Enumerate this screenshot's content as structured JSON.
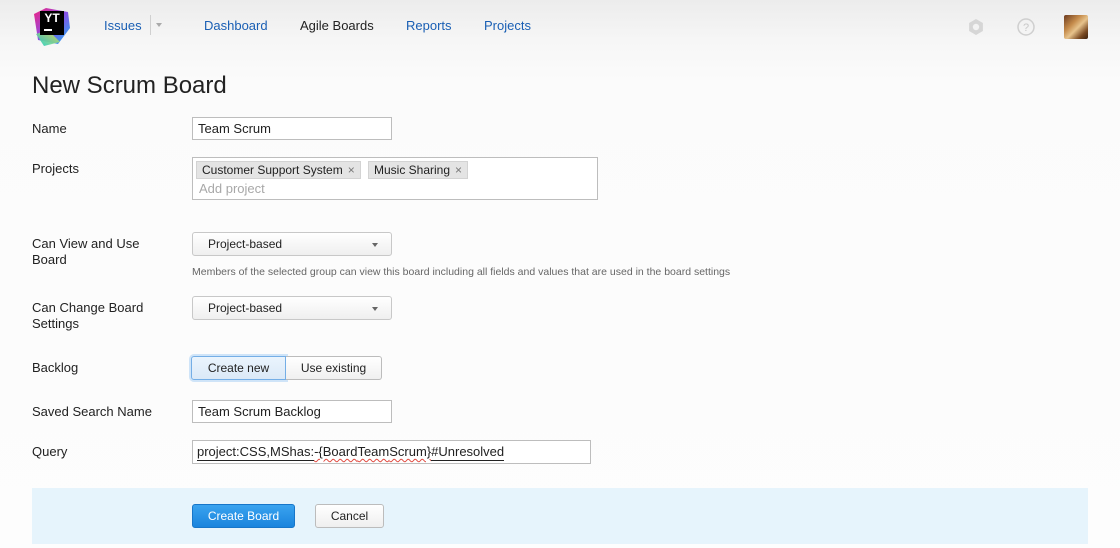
{
  "header": {
    "logo_text": "YT",
    "nav": {
      "issues": "Issues",
      "dashboard": "Dashboard",
      "agile_boards": "Agile Boards",
      "reports": "Reports",
      "projects": "Projects"
    },
    "icons": [
      "settings-icon",
      "help-icon",
      "avatar"
    ]
  },
  "page": {
    "title": "New Scrum Board"
  },
  "form": {
    "name": {
      "label": "Name",
      "value": "Team Scrum"
    },
    "projects": {
      "label": "Projects",
      "tags": [
        "Customer Support System",
        "Music Sharing"
      ],
      "remove_glyph": "×",
      "placeholder": "Add project"
    },
    "can_view": {
      "label": "Can View and Use Board",
      "value": "Project-based",
      "hint": "Members of the selected group can view this board including all fields and values that are used in the board settings"
    },
    "can_change": {
      "label": "Can Change Board Settings",
      "value": "Project-based"
    },
    "backlog": {
      "label": "Backlog",
      "create_new": "Create new",
      "use_existing": "Use existing",
      "selected": "Create new"
    },
    "saved_search": {
      "label": "Saved Search Name",
      "value": "Team Scrum Backlog"
    },
    "query": {
      "label": "Query",
      "value": "project: CSS, MS has: -{Board Team Scrum} #Unresolved"
    }
  },
  "footer": {
    "create_button": "Create Board",
    "cancel_button": "Cancel"
  },
  "colors": {
    "link": "#1a5fb4",
    "primary": "#2b94e8",
    "footer_bg": "#e6f4fc"
  }
}
